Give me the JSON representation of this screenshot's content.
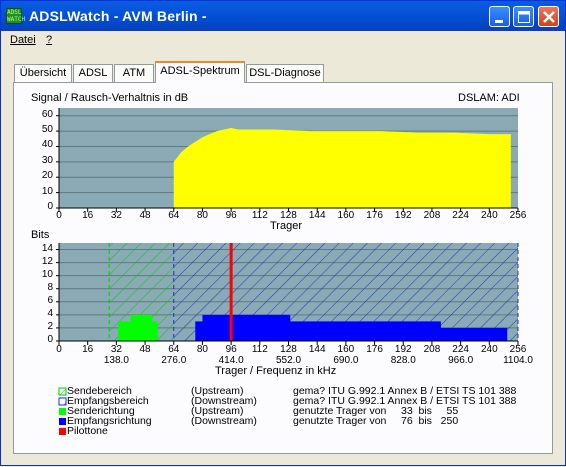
{
  "window": {
    "title": "ADSLWatch   - AVM Berlin -",
    "icon": "adsl-app-icon",
    "icon_text": [
      "ADSL",
      "WATCH"
    ]
  },
  "menu": [
    "Datei",
    "?"
  ],
  "tabs": [
    {
      "label": "Übersicht",
      "active": false
    },
    {
      "label": "ADSL",
      "active": false
    },
    {
      "label": "ATM",
      "active": false
    },
    {
      "label": "ADSL-Spektrum",
      "active": true
    },
    {
      "label": "DSL-Diagnose",
      "active": false
    }
  ],
  "colors": {
    "plot_bg": "#8aabb5",
    "snr_fill": "#ffff00",
    "send": "#00ff00",
    "receive": "#0000ff",
    "pilot": "#ff0000"
  },
  "chart_top": {
    "ylabel": "Signal / Rausch-Verhaltnis in dB",
    "corner_label": "DSLAM: ADI",
    "xlabel": "Trager",
    "x_ticks": [
      "0",
      "16",
      "32",
      "48",
      "64",
      "80",
      "96",
      "112",
      "128",
      "144",
      "160",
      "176",
      "192",
      "208",
      "224",
      "240",
      "256"
    ],
    "y_ticks": [
      "0",
      "10",
      "20",
      "30",
      "40",
      "50",
      "60"
    ]
  },
  "chart_bottom": {
    "ylabel": "Bits",
    "xlabel": "Trager / Frequenz in kHz",
    "x_ticks": [
      "0",
      "16",
      "32",
      "48",
      "64",
      "80",
      "96",
      "112",
      "128",
      "144",
      "160",
      "176",
      "192",
      "208",
      "224",
      "240",
      "256"
    ],
    "freq_ticks": [
      "138.0",
      "276.0",
      "414.0",
      "552.0",
      "690.0",
      "828.0",
      "966.0",
      "1104.0"
    ],
    "y_ticks": [
      "0",
      "2",
      "4",
      "6",
      "8",
      "10",
      "12",
      "14"
    ]
  },
  "chart_data": [
    {
      "type": "area",
      "title": "Signal / Rausch-Verhaltnis in dB",
      "xlabel": "Trager",
      "ylabel": "",
      "xlim": [
        0,
        256
      ],
      "ylim": [
        0,
        65
      ],
      "grid": true,
      "series": [
        {
          "x": [
            64,
            66,
            68,
            70,
            72,
            76,
            80,
            84,
            88,
            92,
            96,
            100,
            110,
            120,
            140,
            160,
            180,
            200,
            220,
            240,
            252
          ],
          "values": [
            30,
            33,
            36,
            38,
            40,
            43,
            46,
            48,
            50,
            51,
            52,
            51,
            51,
            51,
            50,
            50,
            50,
            49,
            49,
            48,
            48
          ]
        }
      ]
    },
    {
      "type": "area",
      "title": "Bits",
      "xlabel": "Trager / Frequenz in kHz",
      "ylabel": "",
      "xlim": [
        0,
        256
      ],
      "ylim": [
        0,
        15
      ],
      "grid": true,
      "series": [
        {
          "name": "Senderichtung",
          "x": [
            33,
            36,
            40,
            44,
            48,
            52,
            55
          ],
          "values": [
            3,
            3,
            4,
            4,
            4,
            3,
            2
          ]
        },
        {
          "name": "Empfangsrichtung",
          "x": [
            76,
            80,
            84,
            128,
            129,
            212,
            213,
            250
          ],
          "values": [
            3,
            4,
            4,
            4,
            3,
            3,
            2,
            2
          ]
        }
      ],
      "sendebereich": [
        28,
        64
      ],
      "empfangsbereich": [
        64,
        256
      ],
      "pilot": 96
    }
  ],
  "legend": [
    {
      "name": "Sendebereich",
      "dir": "(Upstream)",
      "desc": "gema? ITU G.992.1 Annex B / ETSI TS 101 388",
      "swatch": "hatch-green"
    },
    {
      "name": "Empfangsbereich",
      "dir": "(Downstream)",
      "desc": "gema? ITU G.992.1 Annex B / ETSI TS 101 388",
      "swatch": "hatch-blue"
    },
    {
      "name": "Senderichtung",
      "dir": "(Upstream)",
      "desc": "genutzte Trager von     33  bis     55",
      "swatch": "solid-green"
    },
    {
      "name": "Empfangsrichtung",
      "dir": "(Downstream)",
      "desc": "genutzte Trager von     76  bis   250",
      "swatch": "solid-blue"
    },
    {
      "name": "Pilottone",
      "dir": "",
      "desc": "",
      "swatch": "solid-red"
    }
  ]
}
